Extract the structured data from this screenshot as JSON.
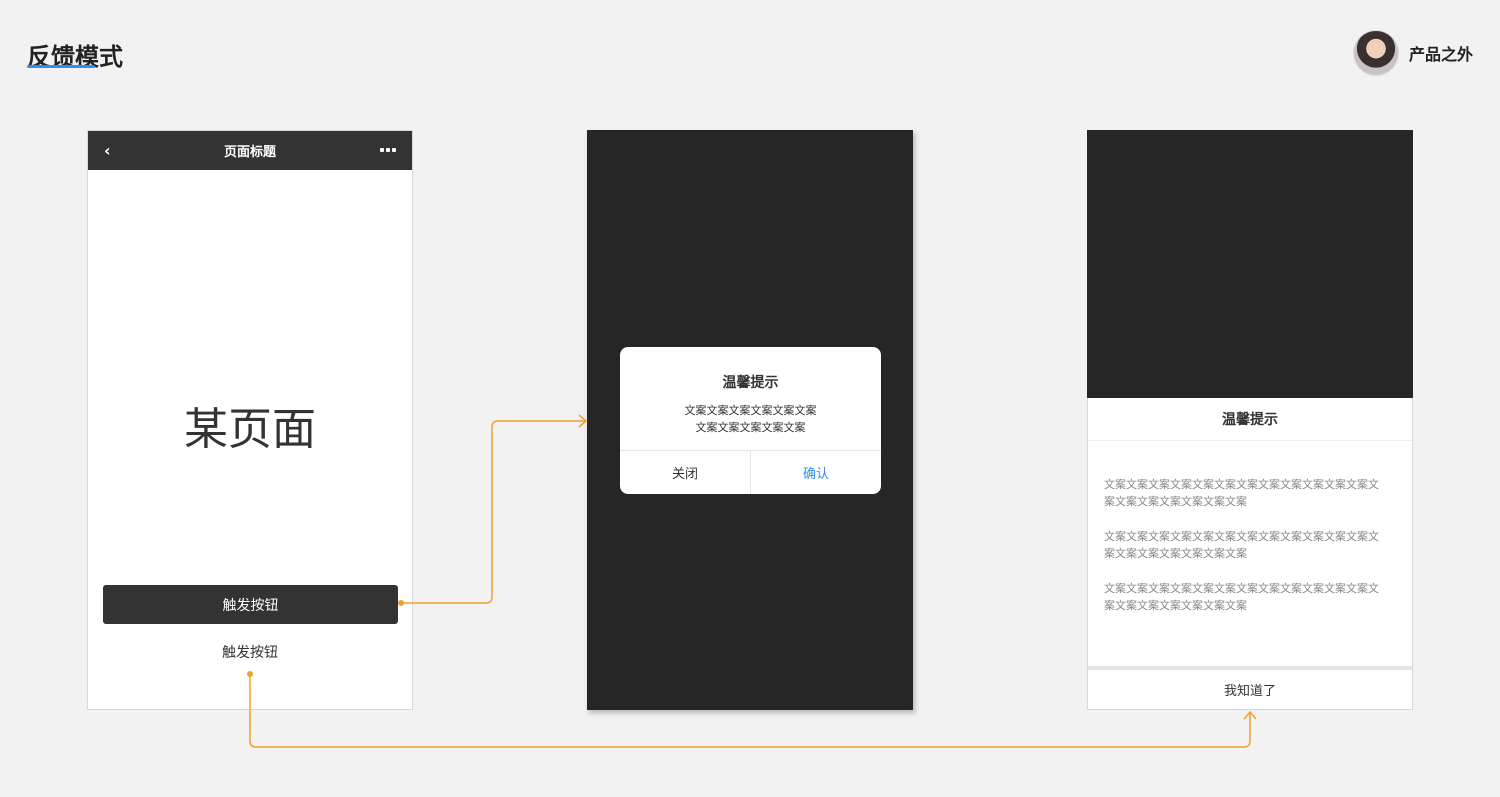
{
  "header": {
    "title": "反馈模式",
    "brand": "产品之外"
  },
  "phone1": {
    "nav_back": "‹",
    "nav_title": "页面标题",
    "page_text": "某页面",
    "primary_button": "触发按钮",
    "text_button": "触发按钮"
  },
  "phone2": {
    "dialog_title": "温馨提示",
    "dialog_lines": [
      "文案文案文案文案文案文案",
      "文案文案文案文案文案"
    ],
    "close_label": "关闭",
    "confirm_label": "确认"
  },
  "phone3": {
    "sheet_title": "温馨提示",
    "paragraphs": [
      "文案文案文案文案文案文案文案文案文案文案文案文案文案文案文案文案文案文案文案",
      "文案文案文案文案文案文案文案文案文案文案文案文案文案文案文案文案文案文案文案",
      "文案文案文案文案文案文案文案文案文案文案文案文案文案文案文案文案文案文案文案"
    ],
    "ok_label": "我知道了"
  },
  "colors": {
    "accent": "#2d8ff0",
    "arrow": "#f0a030",
    "dark": "#262626"
  }
}
